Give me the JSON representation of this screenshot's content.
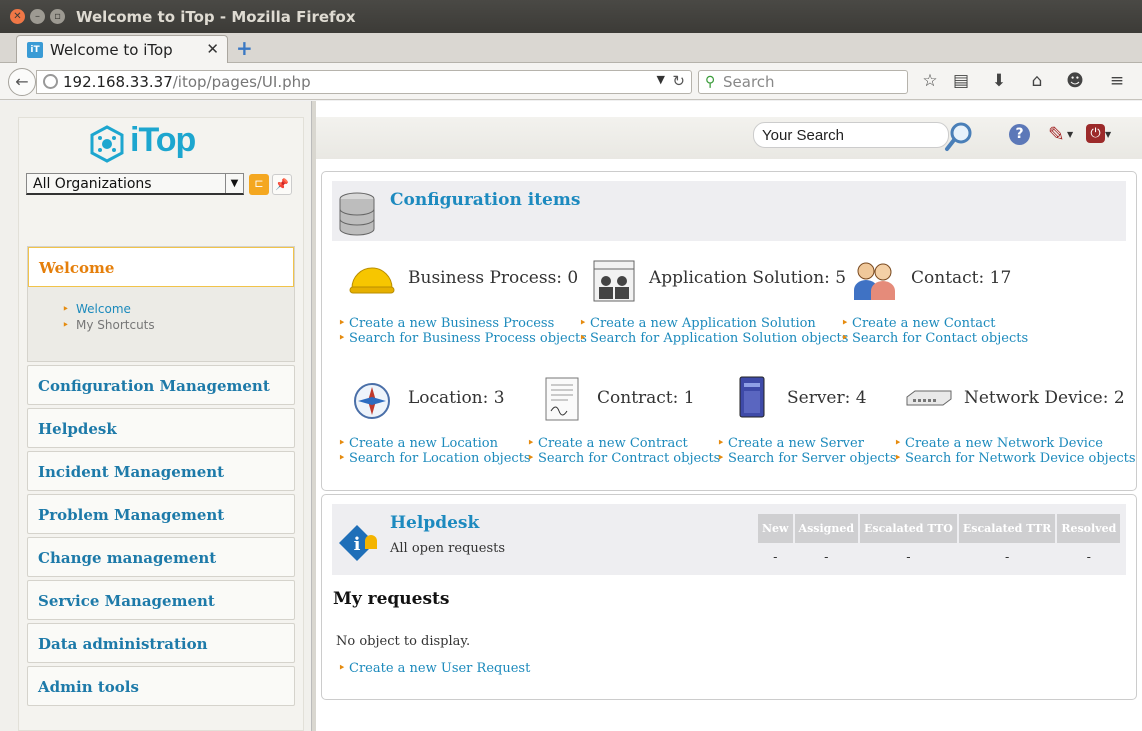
{
  "window": {
    "title": "Welcome to iTop - Mozilla Firefox"
  },
  "browser": {
    "tab_title": "Welcome to iTop",
    "favicon_text": "iT",
    "url_host": "192.168.33.37",
    "url_path": "/itop/pages/UI.php",
    "search_placeholder": "Search"
  },
  "sidebar": {
    "logo_text": "iTop",
    "organization_selected": "All Organizations",
    "welcome_panel": {
      "title": "Welcome",
      "links": [
        "Welcome",
        "My Shortcuts"
      ]
    },
    "menu_items": [
      "Configuration Management",
      "Helpdesk",
      "Incident Management",
      "Problem Management",
      "Change management",
      "Service Management",
      "Data administration",
      "Admin tools"
    ]
  },
  "topbar": {
    "search_value": "Your Search"
  },
  "config_items": {
    "title": "Configuration items",
    "items": [
      {
        "icon": "helmet-icon",
        "label": "Business Process: 0",
        "create": "Create a new Business Process",
        "search": "Search for Business Process objects"
      },
      {
        "icon": "application-solution-icon",
        "label": "Application Solution: 5",
        "create": "Create a new Application Solution",
        "search": "Search for Application Solution objects"
      },
      {
        "icon": "contacts-icon",
        "label": "Contact: 17",
        "create": "Create a new Contact",
        "search": "Search for Contact objects"
      },
      {
        "icon": "compass-icon",
        "label": "Location: 3",
        "create": "Create a new Location",
        "search": "Search for Location objects"
      },
      {
        "icon": "contract-icon",
        "label": "Contract: 1",
        "create": "Create a new Contract",
        "search": "Search for Contract objects"
      },
      {
        "icon": "server-icon",
        "label": "Server: 4",
        "create": "Create a new Server",
        "search": "Search for Server objects"
      },
      {
        "icon": "network-switch-icon",
        "label": "Network Device: 2",
        "create": "Create a new Network Device",
        "search": "Search for Network Device objects"
      }
    ]
  },
  "helpdesk": {
    "title": "Helpdesk",
    "subtitle": "All open requests",
    "columns": [
      "New",
      "Assigned",
      "Escalated TTO",
      "Escalated TTR",
      "Resolved"
    ],
    "values": [
      "-",
      "-",
      "-",
      "-",
      "-"
    ],
    "my_requests_title": "My requests",
    "no_object": "No object to display.",
    "create_link": "Create a new User Request"
  }
}
